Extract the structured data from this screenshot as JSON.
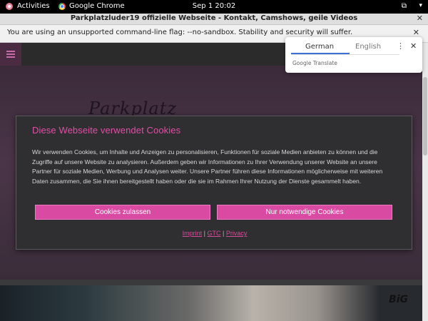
{
  "topbar": {
    "activities": "Activities",
    "app_name": "Google Chrome",
    "clock": "Sep 1  20:02",
    "network_icon": "network-icon",
    "menu_icon": "chevron-down-icon"
  },
  "window": {
    "title": "Parkplatzluder19 offizielle Webseite - Kontakt, Camshows, geile Videos",
    "close": "✕"
  },
  "infobar": {
    "message": "You are using an unsupported command-line flag: --no-sandbox. Stability and security will suffer.",
    "close": "✕"
  },
  "translate": {
    "tab_source": "German",
    "tab_target": "English",
    "brand": "Google Translate",
    "menu": "⋮",
    "close": "✕"
  },
  "site": {
    "logo_text": "Parkplatz",
    "big_badge": "BiG"
  },
  "cookie": {
    "heading": "Diese Webseite verwendet Cookies",
    "body": "Wir verwenden Cookies, um Inhalte und Anzeigen zu personalisieren, Funktionen für soziale Medien anbieten zu können und die Zugriffe auf unsere Website zu analysieren. Außerdem geben wir Informationen zu Ihrer Verwendung unserer Website an unsere Partner für soziale Medien, Werbung und Analysen weiter. Unsere Partner führen diese Informationen möglicherweise mit weiteren Daten zusammen, die Sie ihnen bereitgestellt haben oder die sie im Rahmen Ihrer Nutzung der Dienste gesammelt haben.",
    "accept_label": "Cookies zulassen",
    "necessary_label": "Nur notwendige Cookies",
    "links": {
      "imprint": "Imprint",
      "sep1": "|",
      "gtc": "GTC",
      "sep2": "|",
      "privacy": "Privacy"
    }
  },
  "colors": {
    "accent": "#d94aa3",
    "heading": "#e04fa7",
    "dialog_bg": "#2f2e30"
  }
}
